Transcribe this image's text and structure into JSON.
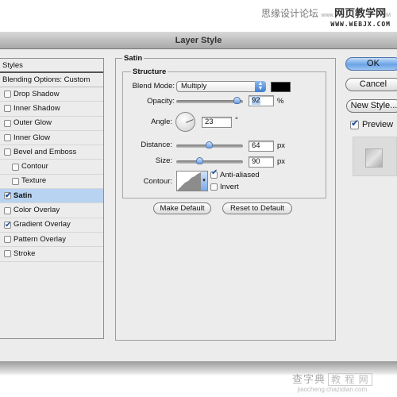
{
  "watermark_top": {
    "line1_cn": "思缘设计论坛",
    "line1_prefix": "www.",
    "line1_bold": "网页教学网",
    "line1_suffix": "M",
    "line2": "WWW.WEBJX.COM"
  },
  "dialog": {
    "title": "Layer Style"
  },
  "styles_panel": {
    "header": "Styles",
    "blending_options": "Blending Options: Custom",
    "items": [
      {
        "label": "Drop Shadow",
        "checked": false,
        "sub": false,
        "selected": false
      },
      {
        "label": "Inner Shadow",
        "checked": false,
        "sub": false,
        "selected": false
      },
      {
        "label": "Outer Glow",
        "checked": false,
        "sub": false,
        "selected": false
      },
      {
        "label": "Inner Glow",
        "checked": false,
        "sub": false,
        "selected": false
      },
      {
        "label": "Bevel and Emboss",
        "checked": false,
        "sub": false,
        "selected": false
      },
      {
        "label": "Contour",
        "checked": false,
        "sub": true,
        "selected": false
      },
      {
        "label": "Texture",
        "checked": false,
        "sub": true,
        "selected": false
      },
      {
        "label": "Satin",
        "checked": true,
        "sub": false,
        "selected": true
      },
      {
        "label": "Color Overlay",
        "checked": false,
        "sub": false,
        "selected": false
      },
      {
        "label": "Gradient Overlay",
        "checked": true,
        "sub": false,
        "selected": false
      },
      {
        "label": "Pattern Overlay",
        "checked": false,
        "sub": false,
        "selected": false
      },
      {
        "label": "Stroke",
        "checked": false,
        "sub": false,
        "selected": false
      }
    ]
  },
  "satin": {
    "group_title": "Satin",
    "structure_title": "Structure",
    "blend_mode_label": "Blend Mode:",
    "blend_mode_value": "Multiply",
    "color": "#000000",
    "opacity_label": "Opacity:",
    "opacity_value": "92",
    "opacity_unit": "%",
    "opacity_fraction": 0.92,
    "angle_label": "Angle:",
    "angle_value": "23",
    "angle_unit": "°",
    "distance_label": "Distance:",
    "distance_value": "64",
    "distance_unit": "px",
    "distance_fraction": 0.5,
    "size_label": "Size:",
    "size_value": "90",
    "size_unit": "px",
    "size_fraction": 0.36,
    "contour_label": "Contour:",
    "anti_aliased_label": "Anti-aliased",
    "anti_aliased_checked": true,
    "invert_label": "Invert",
    "invert_checked": false,
    "make_default": "Make Default",
    "reset_default": "Reset to Default"
  },
  "right_panel": {
    "ok": "OK",
    "cancel": "Cancel",
    "new_style": "New Style...",
    "preview_label": "Preview",
    "preview_checked": true
  },
  "watermark_bottom": {
    "line1_a": "查字典",
    "line1_b": "教 程 网",
    "line2": "jiaocheng.chazidian.com"
  }
}
